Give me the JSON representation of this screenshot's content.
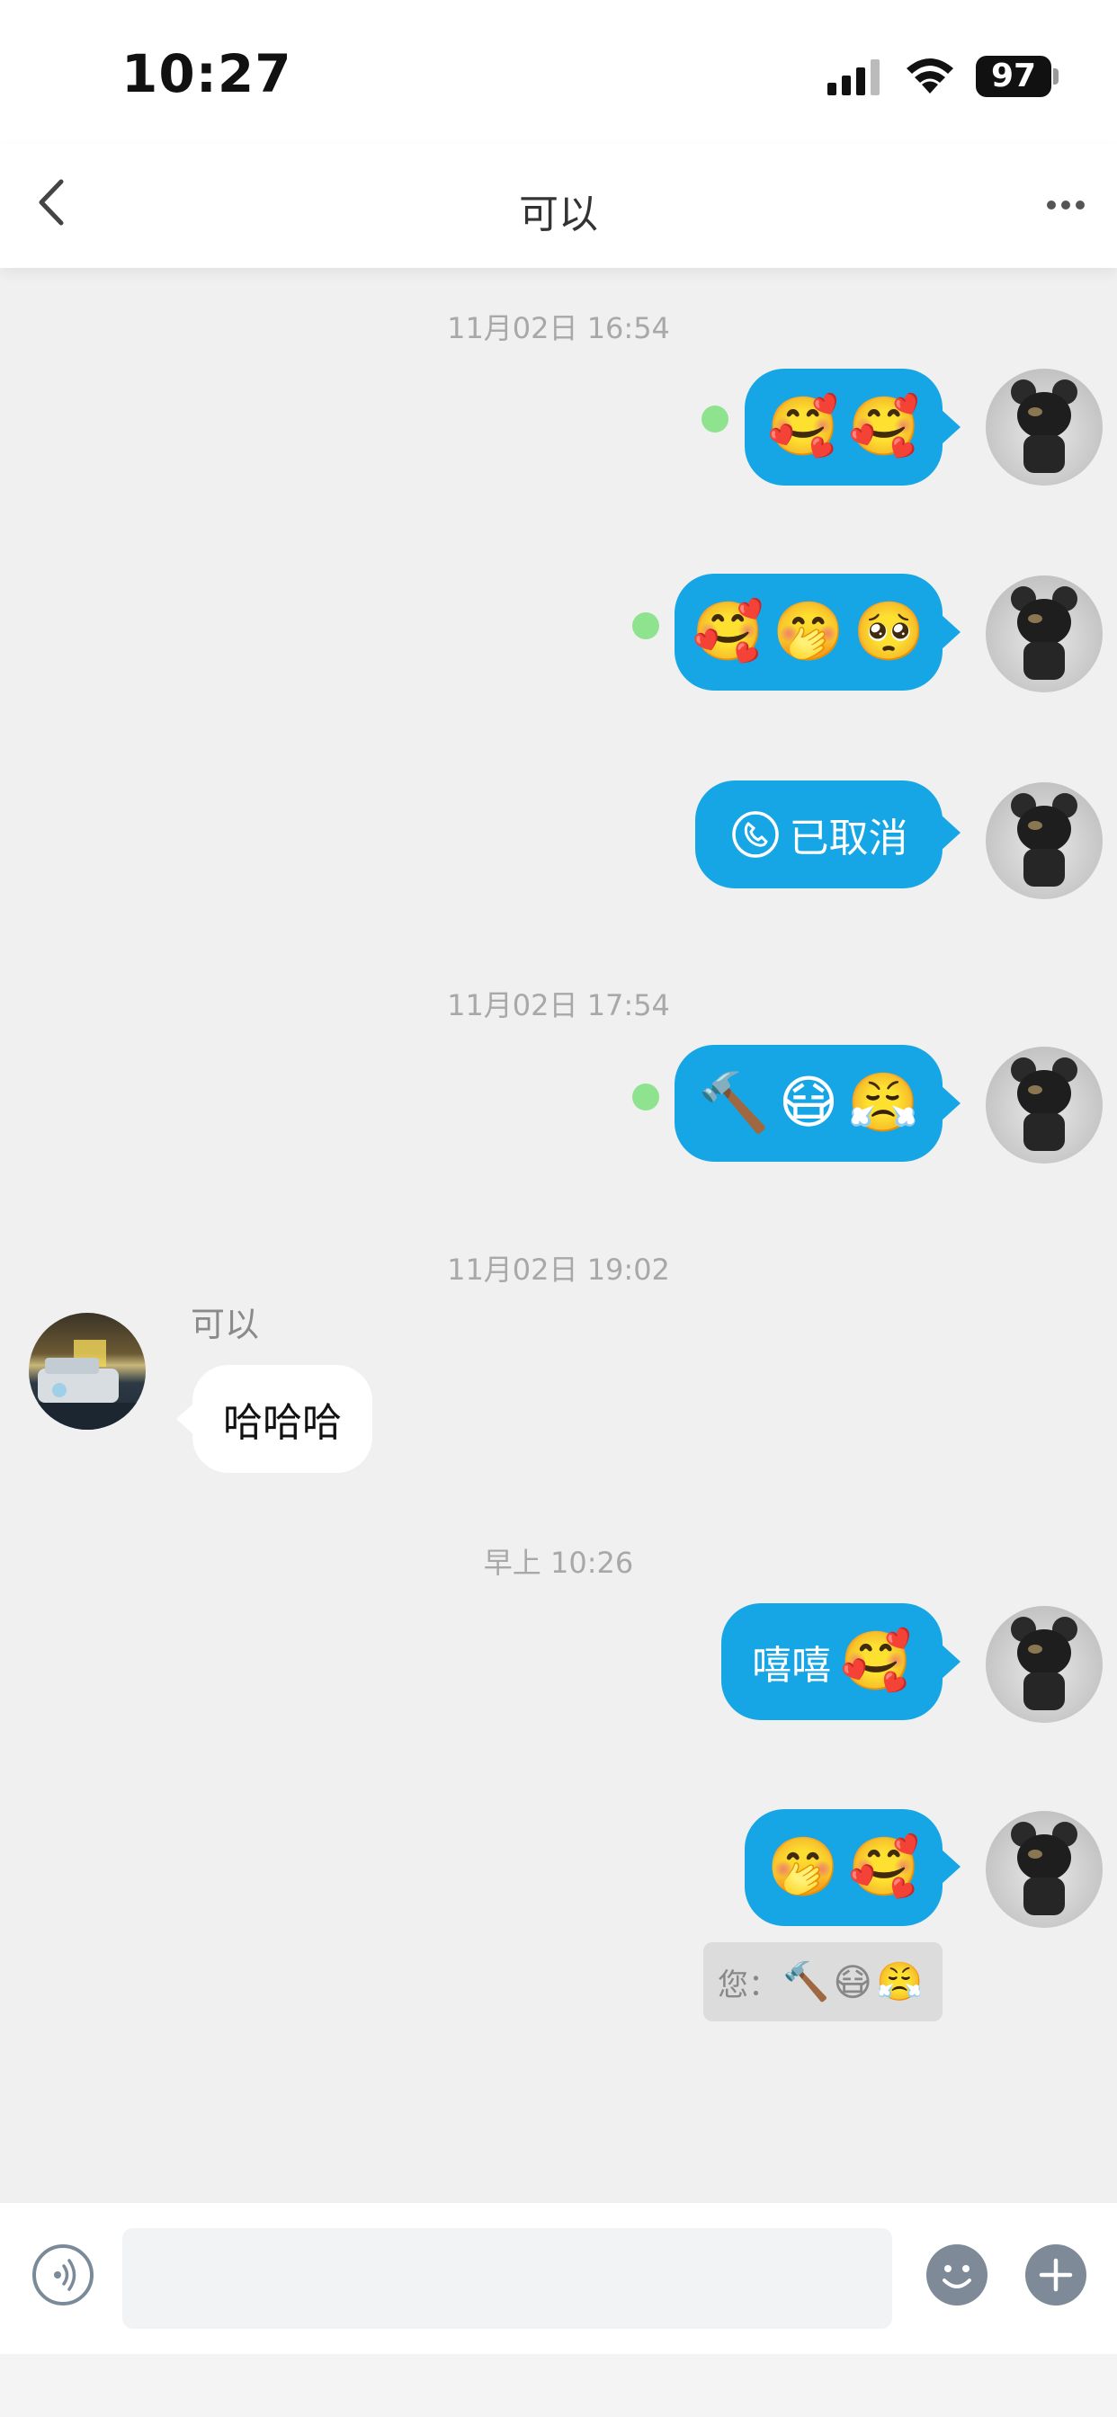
{
  "status_bar": {
    "time": "10:27",
    "battery": "97"
  },
  "nav": {
    "title": "可以"
  },
  "messages": {
    "ts1": "11月02日 16:54",
    "m1": [
      "🥰",
      "🥰"
    ],
    "m2": [
      "🥰",
      "🤭",
      "🥺"
    ],
    "m3_call": "已取消",
    "ts2": "11月02日 17:54",
    "m4": [
      "🔨",
      "😷",
      "😤"
    ],
    "ts3": "11月02日 19:02",
    "sender_name": "可以",
    "m5": "哈哈哈",
    "ts4": "早上 10:26",
    "m6_text": "嘻嘻",
    "m6_emoji": "🥰",
    "m7": [
      "🤭",
      "🥰"
    ],
    "quote_label": "您：",
    "quote_emojis": [
      "🔨",
      "😷",
      "😤"
    ]
  },
  "input": {
    "placeholder": ""
  }
}
